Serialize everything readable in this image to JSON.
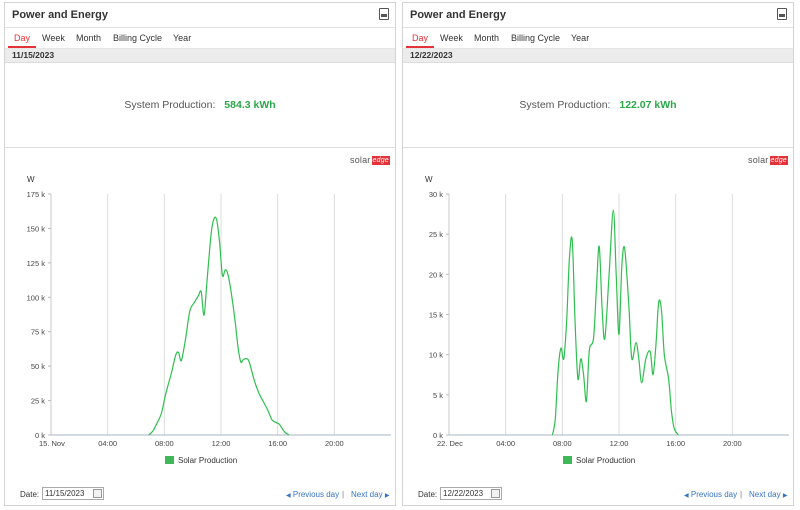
{
  "panels": [
    {
      "title": "Power and Energy",
      "tabs": [
        "Day",
        "Week",
        "Month",
        "Billing Cycle",
        "Year"
      ],
      "active_tab": "Day",
      "current_date": "11/15/2023",
      "production_label": "System Production:",
      "production_value": "584.3 kWh",
      "logo_text": "solar",
      "logo_badge": "edge",
      "footer": {
        "date_label": "Date:",
        "date_value": "11/15/2023",
        "prev_label": "Previous day",
        "separator": "|",
        "next_label": "Next day"
      },
      "chart_data": {
        "type": "area",
        "ylabel": "W",
        "y_ticks": [
          "0 k",
          "25 k",
          "50 k",
          "75 k",
          "100 k",
          "125 k",
          "150 k",
          "175 k"
        ],
        "x_ticks": [
          "15. Nov",
          "04:00",
          "08:00",
          "12:00",
          "16:00",
          "20:00"
        ],
        "ylim": [
          0,
          175000
        ],
        "xlim": [
          0,
          24
        ],
        "series": [
          {
            "name": "Solar Production",
            "color": "#2fbf4f",
            "points": [
              [
                6.9,
                0
              ],
              [
                7.2,
                3000
              ],
              [
                7.5,
                9000
              ],
              [
                7.8,
                16000
              ],
              [
                8.1,
                30000
              ],
              [
                8.5,
                45000
              ],
              [
                8.8,
                58000
              ],
              [
                9.0,
                60000
              ],
              [
                9.2,
                54000
              ],
              [
                9.5,
                70000
              ],
              [
                9.8,
                90000
              ],
              [
                10.1,
                96000
              ],
              [
                10.4,
                101000
              ],
              [
                10.6,
                104000
              ],
              [
                10.8,
                87000
              ],
              [
                11.0,
                110000
              ],
              [
                11.3,
                146000
              ],
              [
                11.5,
                157000
              ],
              [
                11.7,
                156000
              ],
              [
                11.9,
                140000
              ],
              [
                12.1,
                116000
              ],
              [
                12.3,
                120000
              ],
              [
                12.5,
                116000
              ],
              [
                12.8,
                98000
              ],
              [
                13.0,
                82000
              ],
              [
                13.2,
                64000
              ],
              [
                13.4,
                53000
              ],
              [
                13.6,
                55000
              ],
              [
                13.9,
                55000
              ],
              [
                14.1,
                49000
              ],
              [
                14.4,
                38000
              ],
              [
                14.7,
                30000
              ],
              [
                15.0,
                24000
              ],
              [
                15.3,
                18000
              ],
              [
                15.6,
                11000
              ],
              [
                15.9,
                9000
              ],
              [
                16.1,
                8000
              ],
              [
                16.3,
                5000
              ],
              [
                16.5,
                2000
              ],
              [
                16.8,
                0
              ]
            ]
          }
        ],
        "legend": "bottom"
      }
    },
    {
      "title": "Power and Energy",
      "tabs": [
        "Day",
        "Week",
        "Month",
        "Billing Cycle",
        "Year"
      ],
      "active_tab": "Day",
      "current_date": "12/22/2023",
      "production_label": "System Production:",
      "production_value": "122.07 kWh",
      "logo_text": "solar",
      "logo_badge": "edge",
      "footer": {
        "date_label": "Date:",
        "date_value": "12/22/2023",
        "prev_label": "Previous day",
        "separator": "|",
        "next_label": "Next day"
      },
      "chart_data": {
        "type": "area",
        "ylabel": "W",
        "y_ticks": [
          "0 k",
          "5 k",
          "10 k",
          "15 k",
          "20 k",
          "25 k",
          "30 k"
        ],
        "x_ticks": [
          "22. Dec",
          "04:00",
          "08:00",
          "12:00",
          "16:00",
          "20:00"
        ],
        "ylim": [
          0,
          30000
        ],
        "xlim": [
          0,
          24
        ],
        "series": [
          {
            "name": "Solar Production",
            "color": "#2fbf4f",
            "points": [
              [
                7.3,
                0
              ],
              [
                7.5,
                2000
              ],
              [
                7.7,
                8000
              ],
              [
                7.9,
                10800
              ],
              [
                8.1,
                9500
              ],
              [
                8.3,
                14000
              ],
              [
                8.5,
                22000
              ],
              [
                8.7,
                24200
              ],
              [
                8.9,
                14000
              ],
              [
                9.1,
                7000
              ],
              [
                9.3,
                9500
              ],
              [
                9.5,
                7500
              ],
              [
                9.7,
                4200
              ],
              [
                9.9,
                10500
              ],
              [
                10.2,
                12000
              ],
              [
                10.4,
                18000
              ],
              [
                10.6,
                23500
              ],
              [
                10.8,
                16000
              ],
              [
                11.0,
                12000
              ],
              [
                11.3,
                20000
              ],
              [
                11.6,
                28000
              ],
              [
                11.8,
                20000
              ],
              [
                12.0,
                12500
              ],
              [
                12.2,
                21000
              ],
              [
                12.4,
                23200
              ],
              [
                12.7,
                16000
              ],
              [
                12.9,
                9500
              ],
              [
                13.2,
                11500
              ],
              [
                13.4,
                9500
              ],
              [
                13.6,
                6500
              ],
              [
                13.9,
                9500
              ],
              [
                14.2,
                10400
              ],
              [
                14.4,
                7500
              ],
              [
                14.6,
                11000
              ],
              [
                14.8,
                16500
              ],
              [
                15.0,
                15500
              ],
              [
                15.2,
                10000
              ],
              [
                15.5,
                7000
              ],
              [
                15.7,
                3000
              ],
              [
                15.9,
                800
              ],
              [
                16.2,
                0
              ]
            ]
          }
        ],
        "legend": "bottom"
      }
    }
  ]
}
